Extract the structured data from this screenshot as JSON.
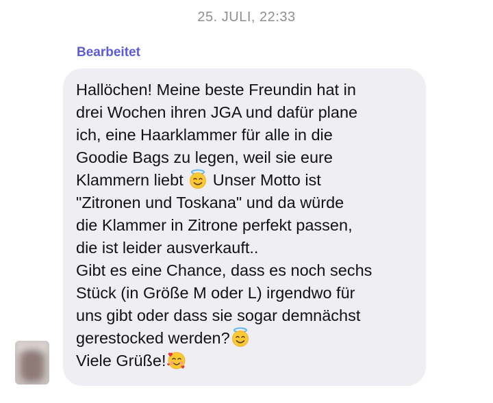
{
  "timestamp": "25. JULI, 22:33",
  "edited_label": "Bearbeitet",
  "message": {
    "line_1": "Hallöchen! Meine beste Freundin hat in",
    "line_2": "drei Wochen ihren JGA und dafür plane",
    "line_3": "ich, eine Haarklammer für alle in die",
    "line_4": "Goodie Bags zu legen, weil sie eure",
    "line_5a": "Klammern liebt",
    "line_5b": "Unser Motto ist",
    "line_6": "\"Zitronen und Toskana\" und da würde",
    "line_7": "die Klammer in Zitrone perfekt passen,",
    "line_8": "die ist leider ausverkauft..",
    "line_9": "Gibt es eine Chance, dass es noch sechs",
    "line_10": "Stück (in Größe M oder L) irgendwo für",
    "line_11": "uns gibt oder dass sie sogar demnächst",
    "line_12": "gerestocked werden?",
    "line_13": "Viele Grüße!"
  },
  "emojis": {
    "halo": "smiling-face-with-halo",
    "hearts": "smiling-face-with-hearts"
  },
  "colors": {
    "bubble": "#eeeef3",
    "edited_label": "#5b5bd6",
    "timestamp": "#8e8e93",
    "text": "#111111"
  }
}
